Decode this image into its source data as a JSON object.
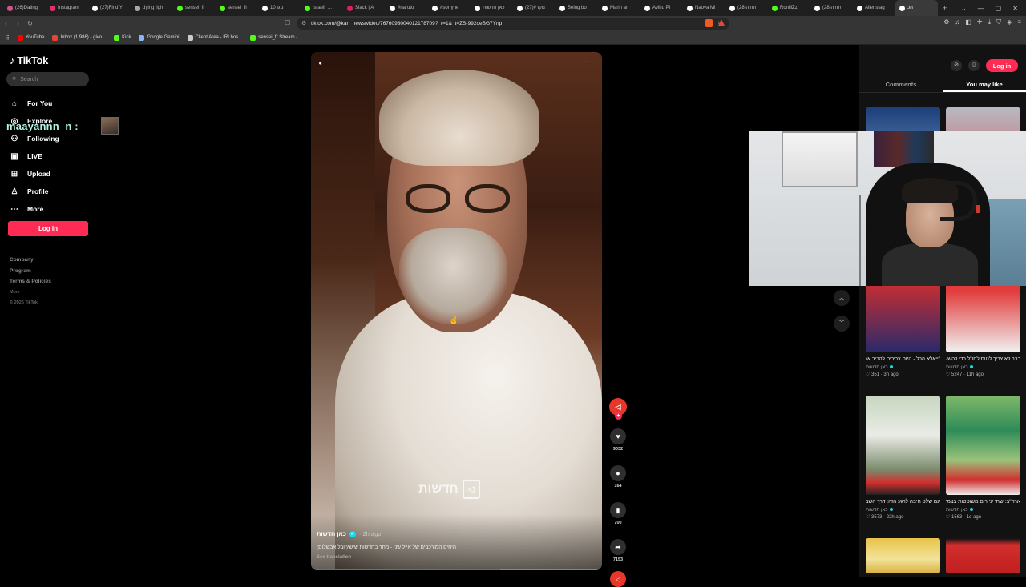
{
  "browser": {
    "tabs": [
      {
        "title": "(26)Dating",
        "color": "#d94f8a"
      },
      {
        "title": "Instagram",
        "color": "#e1306c"
      },
      {
        "title": "(27)Find Y",
        "color": "#ffffff"
      },
      {
        "title": "dying ligh",
        "color": "#aaaaaa"
      },
      {
        "title": "sensei_fr",
        "color": "#53fc18"
      },
      {
        "title": "sensei_fr",
        "color": "#53fc18"
      },
      {
        "title": "10 נוגו",
        "color": "#ffffff"
      },
      {
        "title": "israeli_...",
        "color": "#53fc18"
      },
      {
        "title": "Slack | A",
        "color": "#e01e5a"
      },
      {
        "title": "#naruto",
        "color": "#ffffff"
      },
      {
        "title": "#sorryhe",
        "color": "#ffffff"
      },
      {
        "title": "כאן חדשות",
        "color": "#ffffff"
      },
      {
        "title": "(27)#מקר",
        "color": "#ffffff"
      },
      {
        "title": "Being bo",
        "color": "#ffffff"
      },
      {
        "title": "Marin an",
        "color": "#ffffff"
      },
      {
        "title": "Avihu Pi",
        "color": "#ffffff"
      },
      {
        "title": "Naoya Mi",
        "color": "#ffffff"
      },
      {
        "title": "(28)חזרה",
        "color": "#ffffff"
      },
      {
        "title": "RoniiiZz",
        "color": "#53fc18"
      },
      {
        "title": "(28)חזרה",
        "color": "#ffffff"
      },
      {
        "title": "Alienstag",
        "color": "#ffffff"
      },
      {
        "title": "הכ",
        "color": "#ffffff",
        "active": true
      }
    ],
    "url": "tiktok.com/@kan_news/video/7676093004012178709?_r=1&_t=ZS-992oeBG7Ynp",
    "bookmarks": [
      {
        "label": "YouTube",
        "color": "#ff0000"
      },
      {
        "label": "Inbox (1,986) - givo...",
        "color": "#ea4335"
      },
      {
        "label": "Kick",
        "color": "#53fc18"
      },
      {
        "label": "Google Gemini",
        "color": "#8ab4f8"
      },
      {
        "label": "Client Area - IRLhos...",
        "color": "#cccccc"
      },
      {
        "label": "sensei_fr Stream -...",
        "color": "#53fc18"
      }
    ]
  },
  "sidebar": {
    "logo": "TikTok",
    "search_placeholder": "Search",
    "nav": [
      {
        "label": "For You",
        "icon": "home-icon",
        "glyph": "⌂"
      },
      {
        "label": "Explore",
        "icon": "compass-icon",
        "glyph": "◎"
      },
      {
        "label": "Following",
        "icon": "following-icon",
        "glyph": "⚇"
      },
      {
        "label": "LIVE",
        "icon": "live-icon",
        "glyph": "▣"
      },
      {
        "label": "Upload",
        "icon": "upload-icon",
        "glyph": "⊞"
      },
      {
        "label": "Profile",
        "icon": "profile-icon",
        "glyph": "♙"
      },
      {
        "label": "More",
        "icon": "more-icon",
        "glyph": "⋯"
      }
    ],
    "login_label": "Log in",
    "footer": [
      "Company",
      "Program",
      "Terms & Policies"
    ],
    "footer_more": "More",
    "copyright": "© 2026 TikTok"
  },
  "stream_overlay": {
    "username": "maayannn_n :"
  },
  "video": {
    "author": "כאן חדשות",
    "time": "· 2h ago",
    "caption": "(יובל אבשלום)היחים המורכבים של אייל שני - מחר בחדשות שישי",
    "see_translation": "See translation",
    "watermark": "חדשות",
    "progress": 0.65
  },
  "actions": {
    "likes": "9032",
    "comments": "164",
    "saves": "700",
    "shares": "7153"
  },
  "right_panel": {
    "login_label": "Log in",
    "tabs": [
      "Comments",
      "You may like"
    ],
    "active_tab": "You may like",
    "cards": [
      {
        "title": "\"ייאלא הכל - היום צריכים להכיר את השעה\" יוצאים לבטל ביטוח כל...",
        "author": "כאן חדשות",
        "meta": "♡ 351 · 3h ago",
        "theme": "blue"
      },
      {
        "title": "כבר לא צריך לטוס לחו\"ל כדי להשיג מוצרים של ספורה...",
        "author": "כאן חדשות",
        "meta": "♡ 5247 · 11h ago",
        "theme": "red"
      },
      {
        "title": "עם שלט חיבה לרגע הזה: דרך השבי אליה כהן ובת זוגו...",
        "author": "כאן חדשות",
        "meta": "♡ 3573 · 22h ago",
        "theme": "wedding"
      },
      {
        "title": "ארה\"ב: שתי עיירים משוטטות בצמים שלות לאוטובוס...",
        "author": "כאן חדשות",
        "meta": "♡ 1563 · 1d ago",
        "theme": "bus"
      },
      {
        "title": "",
        "author": "",
        "meta": "",
        "theme": "plate"
      },
      {
        "title": "",
        "author": "",
        "meta": "",
        "theme": "redlogo"
      }
    ]
  }
}
